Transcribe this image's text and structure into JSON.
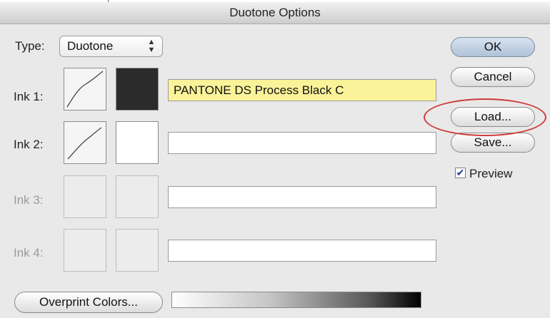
{
  "window": {
    "title": "Duotone Options"
  },
  "type": {
    "label": "Type:",
    "value": "Duotone"
  },
  "inks": [
    {
      "label": "Ink 1:",
      "name": "PANTONE DS Process Black C",
      "swatch_color": "#2b2b2b",
      "enabled": true,
      "has_curve": true
    },
    {
      "label": "Ink 2:",
      "name": "",
      "swatch_color": "#ffffff",
      "enabled": true,
      "has_curve": true
    },
    {
      "label": "Ink 3:",
      "name": "",
      "enabled": false,
      "has_curve": false
    },
    {
      "label": "Ink 4:",
      "name": "",
      "enabled": false,
      "has_curve": false
    }
  ],
  "buttons": {
    "ok": "OK",
    "cancel": "Cancel",
    "load": "Load...",
    "save": "Save...",
    "overprint": "Overprint Colors..."
  },
  "preview": {
    "label": "Preview",
    "checked": true
  },
  "colors": {
    "highlight_field": "#fbf39a",
    "annotation_circle": "#cf3b3b",
    "default_button": "#aec2d8"
  }
}
